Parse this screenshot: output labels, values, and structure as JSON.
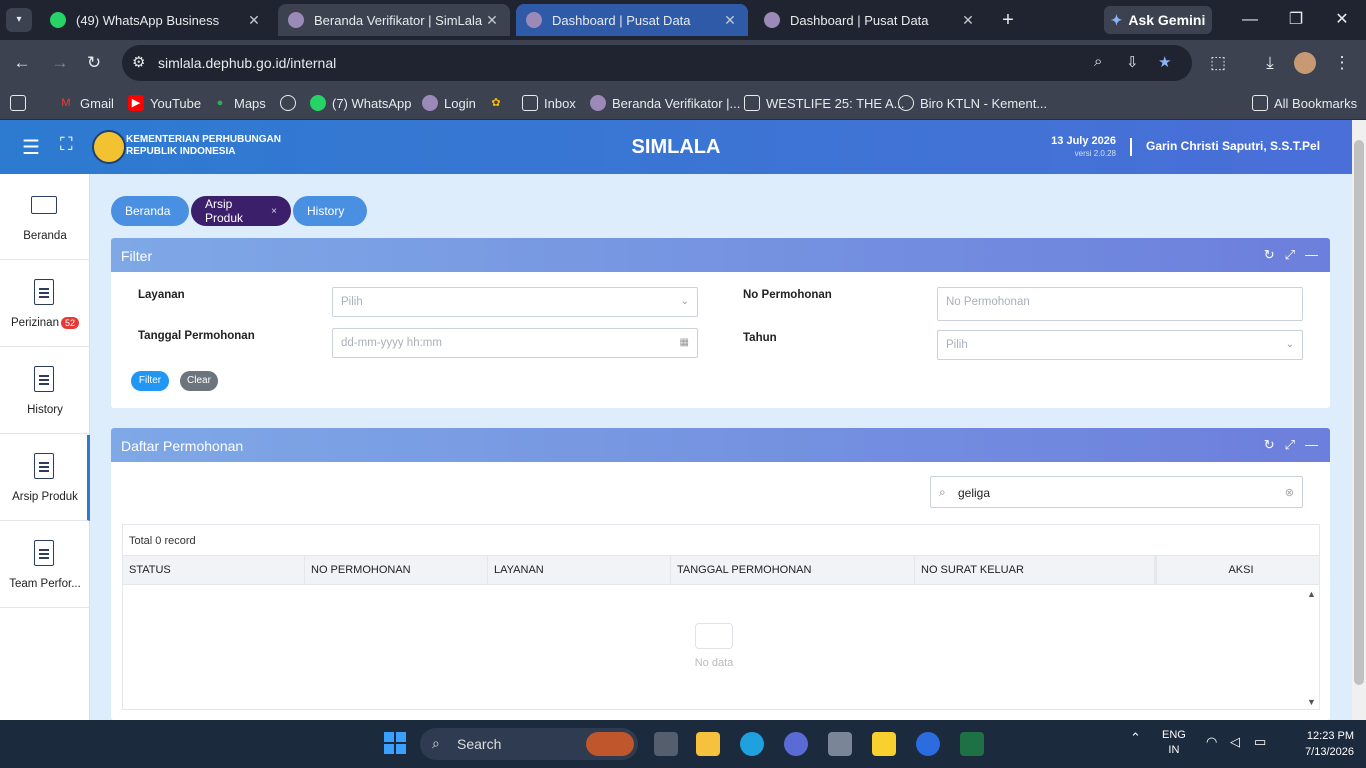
{
  "browser": {
    "tabs": [
      {
        "title": "(49) WhatsApp Business",
        "favicon": "whatsapp-icon",
        "color": "#25d366"
      },
      {
        "title": "Beranda Verifikator | SimLala",
        "favicon": "simlala-icon",
        "color": "#9b8ab8"
      },
      {
        "title": "Dashboard | Pusat Data",
        "favicon": "simlala-icon",
        "color": "#9b8ab8"
      },
      {
        "title": "Dashboard | Pusat Data",
        "favicon": "simlala-icon",
        "color": "#9b8ab8"
      }
    ],
    "ask_gemini": "Ask Gemini",
    "url": "simlala.dephub.go.id/internal",
    "bookmarks": [
      {
        "label": "Gmail",
        "icon": "gmail-icon"
      },
      {
        "label": "YouTube",
        "icon": "youtube-icon"
      },
      {
        "label": "Maps",
        "icon": "maps-icon"
      },
      {
        "label": "",
        "icon": "globe-icon"
      },
      {
        "label": "(7) WhatsApp",
        "icon": "whatsapp-icon"
      },
      {
        "label": "Login",
        "icon": "simlala-icon"
      },
      {
        "label": "",
        "icon": "pinwheel-icon"
      },
      {
        "label": "Inbox",
        "icon": "inbox-icon"
      },
      {
        "label": "Beranda Verifikator |...",
        "icon": "simlala-icon"
      },
      {
        "label": "WESTLIFE 25: THE A...",
        "icon": "page-icon"
      },
      {
        "label": "Biro KTLN - Kement...",
        "icon": "globe-icon"
      }
    ],
    "all_bookmarks": "All Bookmarks"
  },
  "header": {
    "ministry_line1": "KEMENTERIAN PERHUBUNGAN",
    "ministry_line2": "REPUBLIK INDONESIA",
    "app_title": "SIMLALA",
    "date": "13 July 2026",
    "version": "versi 2.0.28",
    "user": "Garin Christi Saputri, S.S.T.Pel"
  },
  "sidebar": {
    "items": [
      {
        "label": "Beranda",
        "icon": "monitor-icon"
      },
      {
        "label": "Perizinan",
        "icon": "document-icon",
        "badge": "52"
      },
      {
        "label": "History",
        "icon": "document-icon"
      },
      {
        "label": "Arsip Produk",
        "icon": "document-icon"
      },
      {
        "label": "Team Perfor...",
        "icon": "document-icon"
      }
    ]
  },
  "page_tabs": [
    {
      "label": "Beranda"
    },
    {
      "label": "Arsip Produk",
      "close": "×"
    },
    {
      "label": "History"
    }
  ],
  "filter": {
    "title": "Filter",
    "layanan_label": "Layanan",
    "layanan_placeholder": "Pilih",
    "tanggal_label": "Tanggal Permohonan",
    "tanggal_placeholder": "dd-mm-yyyy hh:mm",
    "no_permohonan_label": "No Permohonan",
    "no_permohonan_placeholder": "No Permohonan",
    "tahun_label": "Tahun",
    "tahun_placeholder": "Pilih",
    "filter_btn": "Filter",
    "clear_btn": "Clear"
  },
  "daftar": {
    "title": "Daftar Permohonan",
    "search_value": "geliga",
    "total": "Total 0 record",
    "columns": [
      "STATUS",
      "NO PERMOHONAN",
      "LAYANAN",
      "TANGGAL PERMOHONAN",
      "NO SURAT KELUAR",
      "AKSI"
    ],
    "empty": "No data"
  },
  "taskbar": {
    "search": "Search",
    "lang1": "ENG",
    "lang2": "IN",
    "time": "12:23 PM",
    "date": "7/13/2026"
  },
  "colors": {
    "header_gradient": [
      "#2c7bd0",
      "#4a6fd8"
    ],
    "pill_inactive": "#4a90e2",
    "pill_active": "#3b1f6b",
    "panel_header": "#7b8fe0"
  }
}
